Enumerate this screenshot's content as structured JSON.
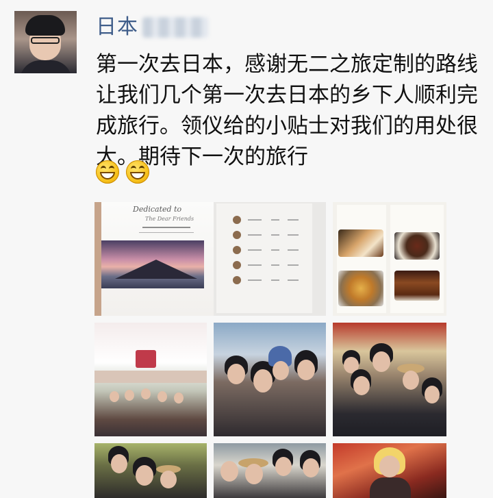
{
  "post": {
    "author_visible": "日本",
    "text": "第一次去日本，感谢无二之旅定制的路线让我们几个第一次去日本的乡下人顺利完成旅行。领仪给的小贴士对我们的用处很大。期待下一次的旅行",
    "emojis": [
      "grinning-face-icon",
      "grinning-face-icon"
    ]
  },
  "photos": {
    "book": {
      "title": "Dedicated to",
      "subtitle": "The Dear Friends"
    }
  },
  "colors": {
    "author_name": "#3f5d8a",
    "background": "#f7f7f7",
    "text": "#111111"
  }
}
